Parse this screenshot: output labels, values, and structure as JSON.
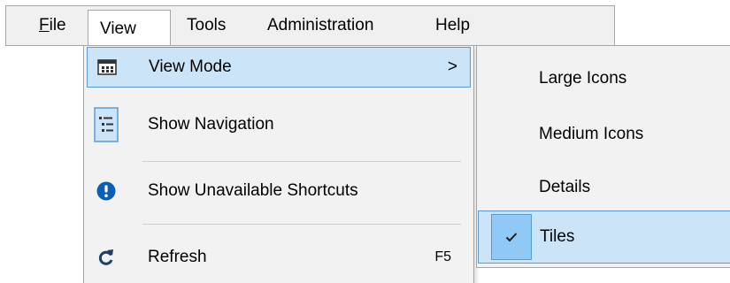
{
  "menubar": {
    "file": {
      "mnemonic": "F",
      "rest": "ile"
    },
    "view": "View",
    "tools": "Tools",
    "administration": "Administration",
    "help": "Help"
  },
  "view_menu": {
    "items": [
      {
        "label": "View Mode",
        "icon": "view-mode-icon",
        "submenu_arrow": ">"
      },
      {
        "label": "Show Navigation",
        "icon": "navigation-icon"
      },
      {
        "label": "Show Unavailable Shortcuts",
        "icon": "info-icon"
      },
      {
        "label": "Refresh",
        "icon": "refresh-icon",
        "shortcut": "F5"
      }
    ]
  },
  "view_mode_submenu": {
    "items": [
      {
        "label": "Large Icons"
      },
      {
        "label": "Medium Icons"
      },
      {
        "label": "Details"
      },
      {
        "label": "Tiles",
        "checked": true
      }
    ]
  },
  "colors": {
    "highlight": "#cce4f7",
    "highlight_border": "#5b9bd5",
    "check_box": "#90c8f6",
    "info_blue": "#0b5fb3"
  }
}
